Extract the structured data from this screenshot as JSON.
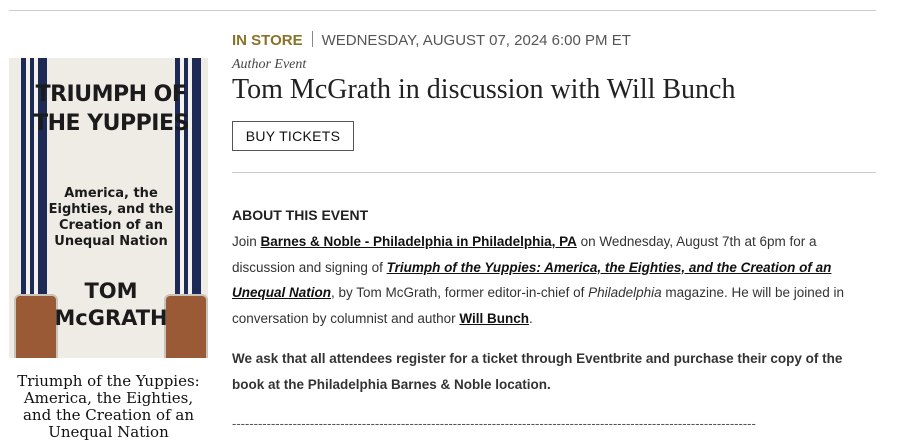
{
  "event": {
    "location_type": "IN STORE",
    "datetime": "WEDNESDAY, AUGUST 07, 2024 6:00 PM ET",
    "kind": "Author Event",
    "title": "Tom McGrath in discussion with Will Bunch",
    "buy_label": "BUY TICKETS"
  },
  "book": {
    "cover_title": "TRIUMPH OF THE YUPPIES",
    "cover_subtitle": "America, the Eighties, and the Creation of an Unequal Nation",
    "cover_author": "TOM McGRATH",
    "caption": "Triumph of the Yuppies: America, the Eighties, and the Creation of an Unequal Nation"
  },
  "about": {
    "heading": "ABOUT THIS EVENT",
    "p1_a": "Join ",
    "store_link": "Barnes & Noble - Philadelphia in Philadelphia, PA",
    "p1_b": " on Wednesday, August 7th at 6pm for a discussion and signing of ",
    "book_link": "Triumph of the Yuppies: America, the Eighties, and the Creation of an Unequal Nation",
    "p1_c": ", by Tom McGrath, former editor-in-chief of ",
    "magazine": "Philadelphia",
    "p1_d": " magazine. He will be joined in conversation by columnist and author ",
    "author_link": "Will Bunch",
    "p1_e": ".",
    "note": "We ask that all attendees register for a ticket through Eventbrite and purchase their copy of the book at the Philadelphia Barnes & Noble location.",
    "divider": "-------------------------------------------------------------------------------------------------------------------------"
  }
}
